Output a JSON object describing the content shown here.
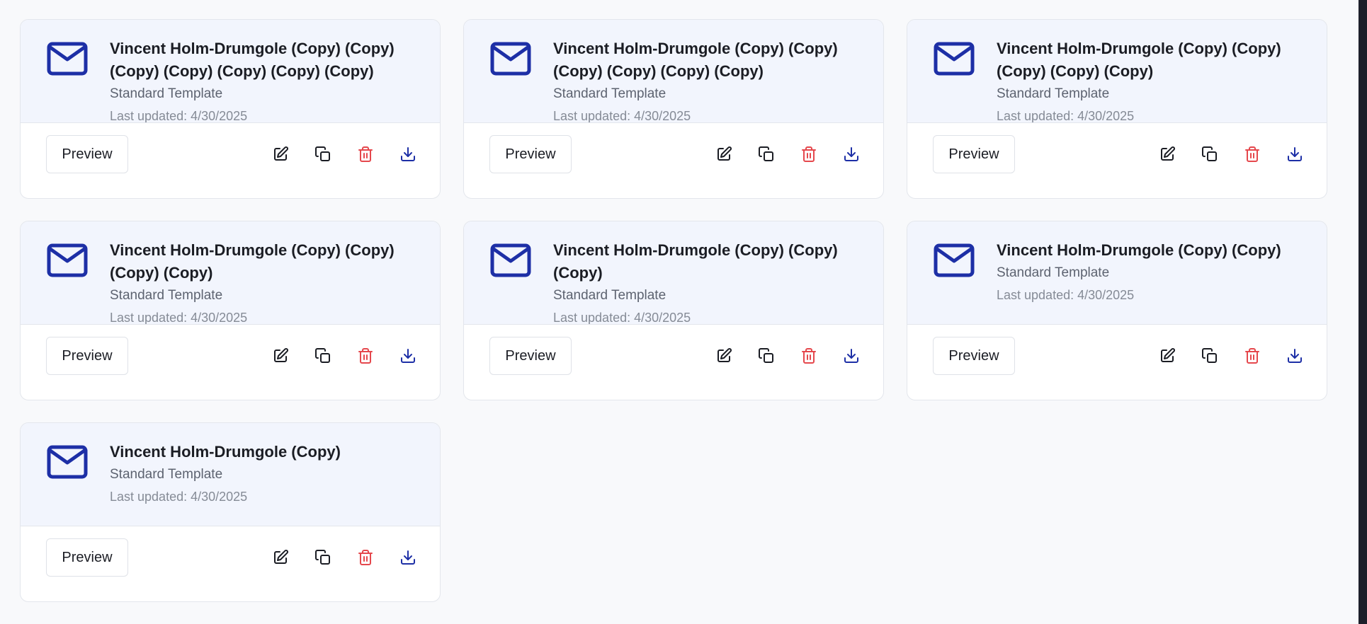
{
  "colors": {
    "accent": "#1d2fa6",
    "danger": "#e5484d",
    "icon": "#1b1d24",
    "card_header_bg": "#f2f5fd",
    "page_bg": "#f8f9fb"
  },
  "icons": {
    "template": "mail-icon",
    "edit": "edit-icon",
    "duplicate": "copy-icon",
    "delete": "trash-icon",
    "download": "download-icon"
  },
  "templates": [
    {
      "title": "Vincent Holm-Drumgole (Copy) (Copy) (Copy) (Copy) (Copy) (Copy) (Copy)",
      "subtitle": "Standard Template",
      "updated": "Last updated: 4/30/2025",
      "preview_label": "Preview"
    },
    {
      "title": "Vincent Holm-Drumgole (Copy) (Copy) (Copy) (Copy) (Copy) (Copy)",
      "subtitle": "Standard Template",
      "updated": "Last updated: 4/30/2025",
      "preview_label": "Preview"
    },
    {
      "title": "Vincent Holm-Drumgole (Copy) (Copy) (Copy) (Copy) (Copy)",
      "subtitle": "Standard Template",
      "updated": "Last updated: 4/30/2025",
      "preview_label": "Preview"
    },
    {
      "title": "Vincent Holm-Drumgole (Copy) (Copy) (Copy) (Copy)",
      "subtitle": "Standard Template",
      "updated": "Last updated: 4/30/2025",
      "preview_label": "Preview"
    },
    {
      "title": "Vincent Holm-Drumgole (Copy) (Copy) (Copy)",
      "subtitle": "Standard Template",
      "updated": "Last updated: 4/30/2025",
      "preview_label": "Preview"
    },
    {
      "title": "Vincent Holm-Drumgole (Copy) (Copy)",
      "subtitle": "Standard Template",
      "updated": "Last updated: 4/30/2025",
      "preview_label": "Preview"
    },
    {
      "title": "Vincent Holm-Drumgole (Copy)",
      "subtitle": "Standard Template",
      "updated": "Last updated: 4/30/2025",
      "preview_label": "Preview"
    }
  ]
}
